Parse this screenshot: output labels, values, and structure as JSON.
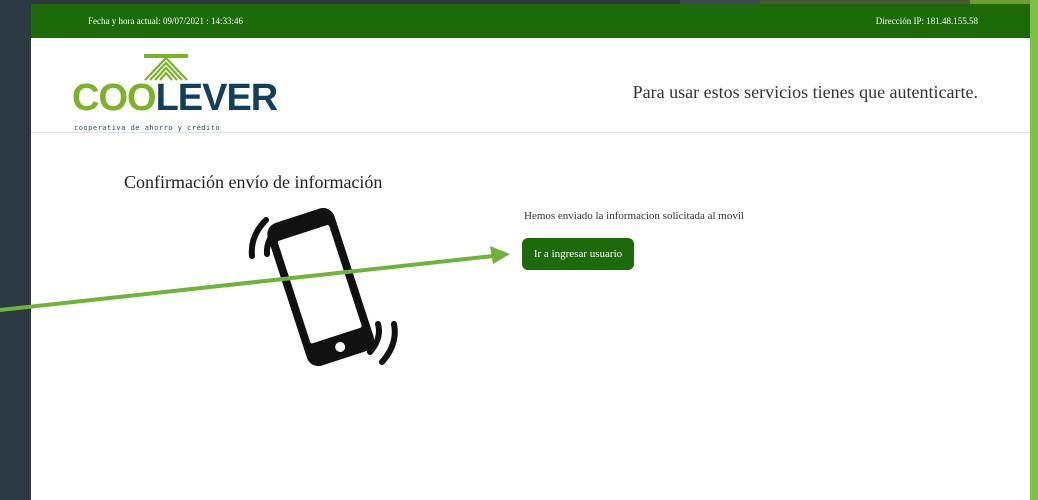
{
  "topbar": {
    "datetime": "Fecha y hora actual: 09/07/2021 : 14:33:46",
    "ip": "Dirección IP: 181.48.155.58"
  },
  "header": {
    "logo_text_left": "COO",
    "logo_text_right": "LEVER",
    "logo_tagline": "cooperativa de ahorro y crédito",
    "auth_message": "Para usar estos servicios tienes que autenticarte."
  },
  "main": {
    "title": "Confirmación envío de información",
    "message": "Hemos enviado la informacion solicitada al movil",
    "button_label": "Ir a ingresar usuario"
  },
  "icons": {
    "phone": "vibrating-phone-icon",
    "arrow": "pointer-arrow"
  },
  "colors": {
    "brand_green": "#1d6a09",
    "logo_green": "#7bb327",
    "logo_navy": "#123f5e",
    "annotation_arrow": "#6fb33a",
    "accent_bar": "#7cc242"
  }
}
